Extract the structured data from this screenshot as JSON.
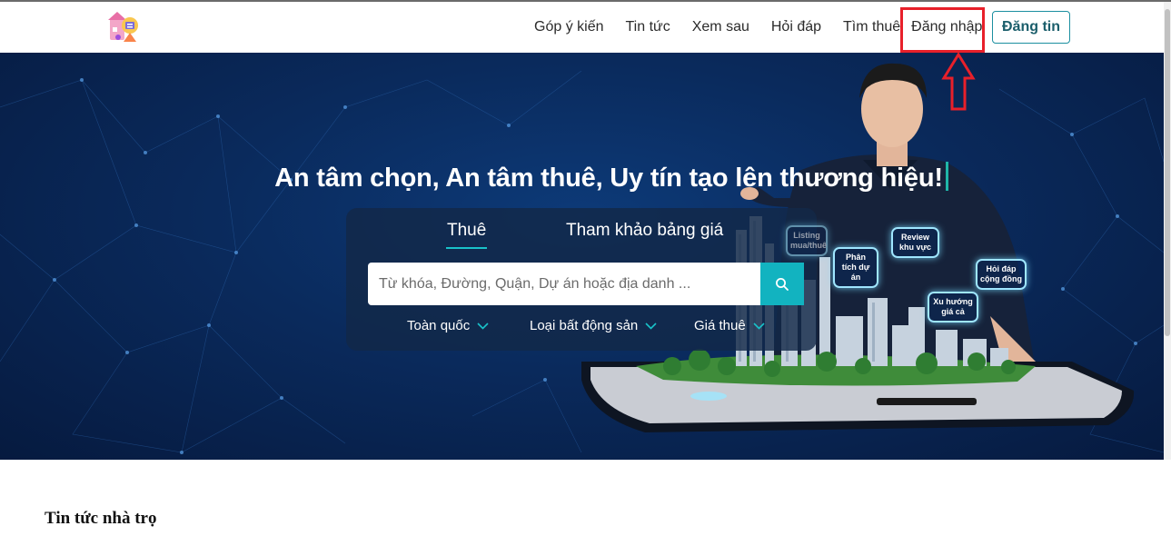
{
  "header": {
    "nav": [
      "Góp ý kiến",
      "Tin tức",
      "Xem sau",
      "Hỏi đáp",
      "Tìm thuê"
    ],
    "login": "Đăng nhập",
    "post_button": "Đăng tin"
  },
  "hero": {
    "title": "An tâm chọn, An tâm thuê, Uy tín tạo lên thương hiệu!",
    "tabs": {
      "rent": "Thuê",
      "price": "Tham khảo bảng giá"
    },
    "search": {
      "placeholder": "Từ khóa, Đường, Quận, Dự án hoặc địa danh ..."
    },
    "filters": {
      "location": "Toàn quốc",
      "property_type": "Loại bất động sản",
      "price": "Giá thuê"
    },
    "bubbles": {
      "listing": "Listing mua/thuê",
      "project": "Phân tích dự án",
      "review": "Review khu vực",
      "qa": "Hỏi đáp cộng đồng",
      "trend": "Xu hướng giá cả"
    }
  },
  "section": {
    "title": "Tin tức nhà trọ"
  },
  "colors": {
    "accent": "#12b3c0",
    "hero_bg": "#0a2a5c",
    "highlight": "#e8202a"
  },
  "icons": {
    "search": "search-icon",
    "chevron": "chevron-down-icon",
    "logo": "logo-icon",
    "arrow": "arrow-up-icon"
  }
}
